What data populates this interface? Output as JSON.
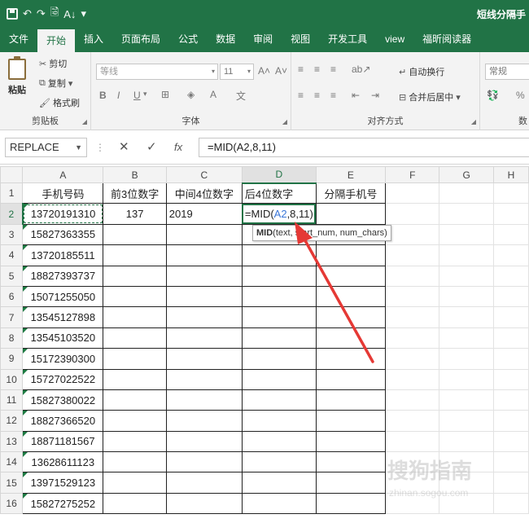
{
  "title_bar": {
    "qat_undo": "↶",
    "qat_redo": "↷",
    "qat_preview": "🗟",
    "qat_sort": "A↓",
    "qat_more": "▾",
    "doc_title": "短线分隔手"
  },
  "tabs": [
    {
      "label": "文件"
    },
    {
      "label": "开始"
    },
    {
      "label": "插入"
    },
    {
      "label": "页面布局"
    },
    {
      "label": "公式"
    },
    {
      "label": "数据"
    },
    {
      "label": "审阅"
    },
    {
      "label": "视图"
    },
    {
      "label": "开发工具"
    },
    {
      "label": "view"
    },
    {
      "label": "福昕阅读器"
    }
  ],
  "ribbon": {
    "clipboard": {
      "paste": "粘贴",
      "cut": "剪切",
      "copy": "复制",
      "format_painter": "格式刷",
      "label": "剪贴板"
    },
    "font": {
      "font_name": "等线",
      "font_size": "11",
      "grow": "A˄",
      "shrink": "A˅",
      "bold": "B",
      "italic": "I",
      "underline": "U",
      "label": "字体"
    },
    "alignment": {
      "wrap": "自动换行",
      "merge": "合并后居中",
      "label": "对齐方式"
    },
    "number": {
      "format": "常规",
      "percent": "%",
      "label": "数"
    }
  },
  "formula_bar": {
    "name_box": "REPLACE",
    "cancel": "✕",
    "enter": "✓",
    "fx": "fx",
    "formula": "=MID(A2,8,11)"
  },
  "sheet": {
    "columns": [
      "A",
      "B",
      "C",
      "D",
      "E",
      "F",
      "G",
      "H"
    ],
    "headers": {
      "a": "手机号码",
      "b": "前3位数字",
      "c": "中间4位数字",
      "d": "后4位数字",
      "e": "分隔手机号"
    },
    "row2": {
      "b": "137",
      "c": "2019",
      "d_prefix": "=MID(",
      "d_ref": "A2",
      "d_suffix": ",8,11)"
    },
    "rows": [
      {
        "num": "1"
      },
      {
        "num": "2",
        "phone": "13720191310"
      },
      {
        "num": "3",
        "phone": "15827363355"
      },
      {
        "num": "4",
        "phone": "13720185511"
      },
      {
        "num": "5",
        "phone": "18827393737"
      },
      {
        "num": "6",
        "phone": "15071255050"
      },
      {
        "num": "7",
        "phone": "13545127898"
      },
      {
        "num": "8",
        "phone": "13545103520"
      },
      {
        "num": "9",
        "phone": "15172390300"
      },
      {
        "num": "10",
        "phone": "15727022522"
      },
      {
        "num": "11",
        "phone": "15827380022"
      },
      {
        "num": "12",
        "phone": "18827366520"
      },
      {
        "num": "13",
        "phone": "18871181567"
      },
      {
        "num": "14",
        "phone": "13628611123"
      },
      {
        "num": "15",
        "phone": "13971529123"
      },
      {
        "num": "16",
        "phone": "15827275252"
      }
    ]
  },
  "tooltip": {
    "fn": "MID",
    "args": "(text, start_num, num_chars)"
  },
  "watermark": {
    "text": "搜狗指南",
    "url": "zhinan.sogou.com"
  },
  "colors": {
    "excel_green": "#217346",
    "arrow_red": "#e53935",
    "ref_blue": "#3c78d8"
  }
}
